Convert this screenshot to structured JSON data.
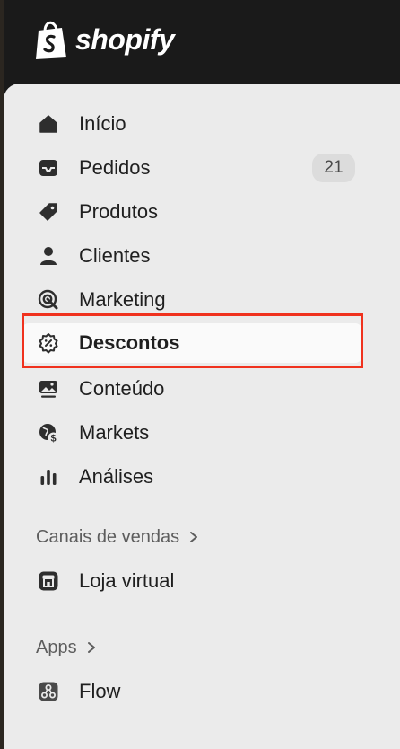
{
  "brand": {
    "name": "shopify"
  },
  "nav": {
    "items": [
      {
        "label": "Início",
        "icon": "home-icon"
      },
      {
        "label": "Pedidos",
        "icon": "inbox-icon",
        "badge": "21"
      },
      {
        "label": "Produtos",
        "icon": "tag-icon"
      },
      {
        "label": "Clientes",
        "icon": "person-icon"
      },
      {
        "label": "Marketing",
        "icon": "target-icon"
      },
      {
        "label": "Descontos",
        "icon": "discount-icon",
        "active": true
      },
      {
        "label": "Conteúdo",
        "icon": "image-icon"
      },
      {
        "label": "Markets",
        "icon": "globe-dollar-icon"
      },
      {
        "label": "Análises",
        "icon": "bar-chart-icon"
      }
    ]
  },
  "sales_channels": {
    "heading": "Canais de vendas",
    "items": [
      {
        "label": "Loja virtual",
        "icon": "store-icon"
      }
    ]
  },
  "apps": {
    "heading": "Apps",
    "items": [
      {
        "label": "Flow",
        "icon": "flow-icon"
      }
    ]
  },
  "colors": {
    "highlight": "#f0321e",
    "sidebar_bg": "#ebebeb",
    "topbar_bg": "#1a1a1a"
  }
}
